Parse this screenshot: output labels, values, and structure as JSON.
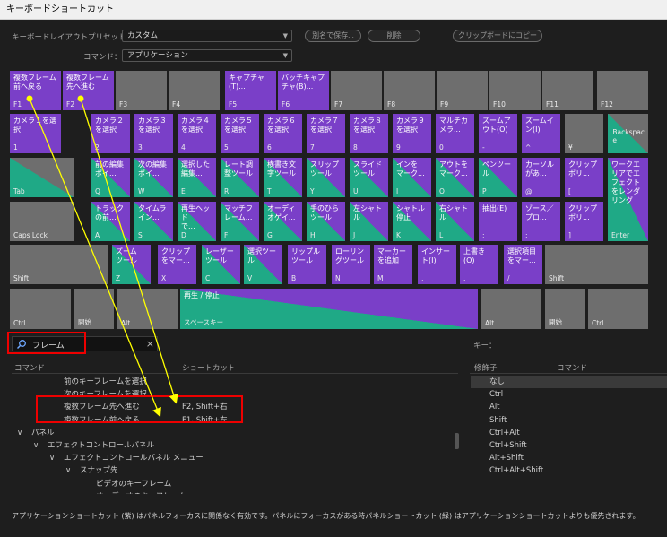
{
  "window": {
    "title": "キーボードショートカット"
  },
  "form": {
    "layout_preset_label": "キーボードレイアウトプリセット：",
    "layout_preset_value": "カスタム",
    "command_label": "コマンド：",
    "command_value": "アプリケーション",
    "save_as_button": "別名で保存...",
    "delete_button": "削除",
    "copy_clipboard_button": "クリップボードにコピー"
  },
  "keyboard": {
    "keys": [
      {
        "id": "f1",
        "label": "複数フレーム\n前へ戻る",
        "code": "F1",
        "type": "app"
      },
      {
        "id": "f2",
        "label": "複数フレーム\n先へ進む",
        "code": "F2",
        "type": "app"
      },
      {
        "id": "f3",
        "label": "",
        "code": "F3",
        "type": "none"
      },
      {
        "id": "f4",
        "label": "",
        "code": "F4",
        "type": "none"
      },
      {
        "id": "f5",
        "label": "キャプチャ\n(T)...",
        "code": "F5",
        "type": "app"
      },
      {
        "id": "f6",
        "label": "バッチキャプ\nチャ(B)...",
        "code": "F6",
        "type": "app"
      },
      {
        "id": "f7",
        "label": "",
        "code": "F7",
        "type": "none"
      },
      {
        "id": "f8",
        "label": "",
        "code": "F8",
        "type": "none"
      },
      {
        "id": "f9",
        "label": "",
        "code": "F9",
        "type": "none"
      },
      {
        "id": "f10",
        "label": "",
        "code": "F10",
        "type": "none"
      },
      {
        "id": "f11",
        "label": "",
        "code": "F11",
        "type": "none"
      },
      {
        "id": "f12",
        "label": "",
        "code": "F12",
        "type": "none"
      },
      {
        "id": "k1",
        "label": "カメラ１を選択",
        "code": "1",
        "type": "app"
      },
      {
        "id": "k2",
        "label": "カメラ２\nを選択",
        "code": "2",
        "type": "app"
      },
      {
        "id": "k3",
        "label": "カメラ３\nを選択",
        "code": "3",
        "type": "app"
      },
      {
        "id": "k4",
        "label": "カメラ４\nを選択",
        "code": "4",
        "type": "app"
      },
      {
        "id": "k5",
        "label": "カメラ５\nを選択",
        "code": "5",
        "type": "app"
      },
      {
        "id": "k6",
        "label": "カメラ６\nを選択",
        "code": "6",
        "type": "app"
      },
      {
        "id": "k7",
        "label": "カメラ７\nを選択",
        "code": "7",
        "type": "app"
      },
      {
        "id": "k8",
        "label": "カメラ８\nを選択",
        "code": "8",
        "type": "app"
      },
      {
        "id": "k9",
        "label": "カメラ９\nを選択",
        "code": "9",
        "type": "app"
      },
      {
        "id": "k0",
        "label": "マルチカ\nメラ...",
        "code": "0",
        "type": "app"
      },
      {
        "id": "kminus",
        "label": "ズームア\nウト(O)",
        "code": "-",
        "type": "app"
      },
      {
        "id": "kcaret",
        "label": "ズームイ\nン(I)",
        "code": "^",
        "type": "app"
      },
      {
        "id": "kyen",
        "label": "",
        "code": "¥",
        "type": "none"
      },
      {
        "id": "kbs",
        "label": "",
        "code": "Backspac\ne",
        "type": "mix-grey-pnl"
      },
      {
        "id": "ktab",
        "label": "",
        "code": "Tab",
        "type": "mix-grey-pnl"
      },
      {
        "id": "kq",
        "label": "前の編集\nポイ...",
        "code": "Q",
        "type": "mix-app-pnl"
      },
      {
        "id": "kw",
        "label": "次の編集\nポイ...",
        "code": "W",
        "type": "mix-app-pnl"
      },
      {
        "id": "ke",
        "label": "選択した\n編集...",
        "code": "E",
        "type": "mix-app-pnl"
      },
      {
        "id": "kr",
        "label": "レート調\n整ツール",
        "code": "R",
        "type": "mix-app-pnl"
      },
      {
        "id": "kt",
        "label": "横書き文\n字ツール",
        "code": "T",
        "type": "mix-app-pnl"
      },
      {
        "id": "ky",
        "label": "スリップ\nツール",
        "code": "Y",
        "type": "mix-app-pnl"
      },
      {
        "id": "ku",
        "label": "スライド\nツール",
        "code": "U",
        "type": "mix-app-pnl"
      },
      {
        "id": "ki",
        "label": "インを\nマーク...",
        "code": "I",
        "type": "mix-app-pnl"
      },
      {
        "id": "ko",
        "label": "アウトを\nマーク...",
        "code": "O",
        "type": "mix-app-pnl"
      },
      {
        "id": "kp",
        "label": "ペンツー\nル",
        "code": "P",
        "type": "mix-app-pnl"
      },
      {
        "id": "kat",
        "label": "カーソル\nがあ...",
        "code": "@",
        "type": "app"
      },
      {
        "id": "klbr",
        "label": "クリップ\nボリ...",
        "code": "[",
        "type": "app"
      },
      {
        "id": "kenter",
        "label": "ワークエ\nリアでエ\nフェクト\nをレンダ\nリング",
        "code": "Enter",
        "type": "mix-app-pnl"
      },
      {
        "id": "kcaps",
        "label": "",
        "code": "Caps Lock",
        "type": "none"
      },
      {
        "id": "ka",
        "label": "トラック\nの前...",
        "code": "A",
        "type": "mix-app-pnl"
      },
      {
        "id": "ks",
        "label": "タイムラ\nイン...",
        "code": "S",
        "type": "mix-app-pnl"
      },
      {
        "id": "kd",
        "label": "再生ヘッド\nで...",
        "code": "D",
        "type": "mix-app-pnl"
      },
      {
        "id": "kf",
        "label": "マッチフ\nレーム...",
        "code": "F",
        "type": "mix-app-pnl"
      },
      {
        "id": "kg",
        "label": "オーディ\nオゲイ...",
        "code": "G",
        "type": "mix-app-pnl"
      },
      {
        "id": "kh",
        "label": "手のひら\nツール",
        "code": "H",
        "type": "mix-app-pnl"
      },
      {
        "id": "kj",
        "label": "左シャト\nル",
        "code": "J",
        "type": "mix-app-pnl"
      },
      {
        "id": "kk",
        "label": "シャトル\n停止",
        "code": "K",
        "type": "mix-app-pnl"
      },
      {
        "id": "kl",
        "label": "右シャト\nル",
        "code": "L",
        "type": "mix-app-pnl"
      },
      {
        "id": "ksemi",
        "label": "抽出(E)",
        "code": ";",
        "type": "app"
      },
      {
        "id": "kcolon",
        "label": "ゾース／\nプロ...",
        "code": ":",
        "type": "app"
      },
      {
        "id": "krbr",
        "label": "クリップ\nボリ...",
        "code": "]",
        "type": "app"
      },
      {
        "id": "kshiftl",
        "label": "",
        "code": "Shift",
        "type": "none"
      },
      {
        "id": "kz",
        "label": "ズーム\nツール",
        "code": "Z",
        "type": "mix-app-pnl"
      },
      {
        "id": "kx",
        "label": "クリップ\nをマー...",
        "code": "X",
        "type": "app"
      },
      {
        "id": "kc",
        "label": "レーザー\nツール",
        "code": "C",
        "type": "mix-app-pnl"
      },
      {
        "id": "kv",
        "label": "選択ツー\nル",
        "code": "V",
        "type": "mix-app-pnl"
      },
      {
        "id": "kb",
        "label": "リップル\nツール",
        "code": "B",
        "type": "app"
      },
      {
        "id": "kn",
        "label": "ローリン\nグツール",
        "code": "N",
        "type": "app"
      },
      {
        "id": "km",
        "label": "マーカー\nを追加",
        "code": "M",
        "type": "app"
      },
      {
        "id": "kcomma",
        "label": "インサー\nト(I)",
        "code": ",",
        "type": "app"
      },
      {
        "id": "kdot",
        "label": "上書き\n(O)",
        "code": ".",
        "type": "app"
      },
      {
        "id": "kslash",
        "label": "選択項目\nをマー...",
        "code": "/",
        "type": "app"
      },
      {
        "id": "kshiftr",
        "label": "",
        "code": "Shift",
        "type": "none"
      },
      {
        "id": "kctrll",
        "label": "",
        "code": "Ctrl",
        "type": "none"
      },
      {
        "id": "kwinl",
        "label": "",
        "code": "開始",
        "type": "none"
      },
      {
        "id": "kaltl",
        "label": "",
        "code": "Alt",
        "type": "none"
      },
      {
        "id": "kspace",
        "label": "再生 / 停止",
        "code": "スペースキー",
        "type": "mix-app-pnl"
      },
      {
        "id": "kaltr",
        "label": "",
        "code": "Alt",
        "type": "none"
      },
      {
        "id": "kwinr",
        "label": "",
        "code": "開始",
        "type": "none"
      },
      {
        "id": "kctrlr",
        "label": "",
        "code": "Ctrl",
        "type": "none"
      }
    ]
  },
  "search": {
    "value": "フレーム"
  },
  "key_label": "キー：",
  "commands_panel": {
    "col_command": "コマンド",
    "col_shortcut": "ショートカット",
    "rows": [
      {
        "label": "前のキーフレームを選択",
        "shortcut": "",
        "level": 2,
        "toggle": ""
      },
      {
        "label": "次のキーフレームを選択",
        "shortcut": "",
        "level": 2,
        "toggle": ""
      },
      {
        "label": "複数フレーム先へ進む",
        "shortcut": "F2, Shift+右",
        "level": 2,
        "toggle": ""
      },
      {
        "label": "複数フレーム前へ戻る",
        "shortcut": "F1, Shift+左",
        "level": 2,
        "toggle": ""
      },
      {
        "label": "パネル",
        "shortcut": "",
        "level": 0,
        "toggle": "∨"
      },
      {
        "label": "エフェクトコントロールパネル",
        "shortcut": "",
        "level": 1,
        "toggle": "∨"
      },
      {
        "label": "エフェクトコントロールパネル メニュー",
        "shortcut": "",
        "level": 2,
        "toggle": "∨"
      },
      {
        "label": "スナップ先",
        "shortcut": "",
        "level": 3,
        "toggle": "∨"
      },
      {
        "label": "ビデオのキーフレーム",
        "shortcut": "",
        "level": 4,
        "toggle": ""
      },
      {
        "label": "オーディオのキーフレーム",
        "shortcut": "",
        "level": 4,
        "toggle": ""
      }
    ]
  },
  "modifiers_panel": {
    "col_modifier": "修飾子",
    "col_command": "コマンド",
    "rows": [
      "なし",
      "Ctrl",
      "Alt",
      "Shift",
      "Ctrl+Alt",
      "Ctrl+Shift",
      "Alt+Shift",
      "Ctrl+Alt+Shift"
    ]
  },
  "footer": "アプリケーションショートカット (紫) はパネルフォーカスに関係なく有効です。パネルにフォーカスがある時パネルショートカット (緑) はアプリケーションショートカットよりも優先されます。",
  "colors": {
    "application": "#7a3fc8",
    "panel": "#1fa986",
    "unassigned": "#6e6e6e",
    "annotation": "#e00000",
    "arrow": "#ffff00"
  }
}
